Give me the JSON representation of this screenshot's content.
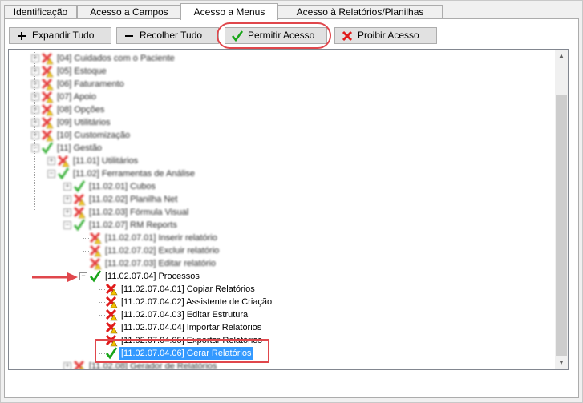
{
  "tabs": [
    {
      "label": "Identificação"
    },
    {
      "label": "Acesso a Campos"
    },
    {
      "label": "Acesso a Menus"
    },
    {
      "label": "Acesso à Relatórios/Planilhas"
    }
  ],
  "toolbar": {
    "expand_label": "Expandir Tudo",
    "collapse_label": "Recolher Tudo",
    "allow_label": "Permitir Acesso",
    "deny_label": "Proibir Acesso"
  },
  "colors": {
    "allowed": "#1aa51a",
    "denied": "#e01b1b",
    "warning": "#f2c200",
    "annotation": "#e0474c",
    "selection": "#3399ff"
  },
  "tree": [
    {
      "label": "[04] Cuidados com o Paciente",
      "status": "denied-warning",
      "blurred": true
    },
    {
      "label": "[05] Estoque",
      "status": "denied-warning",
      "blurred": true
    },
    {
      "label": "[06] Faturamento",
      "status": "denied-warning",
      "blurred": true
    },
    {
      "label": "[07] Apoio",
      "status": "denied-warning",
      "blurred": true
    },
    {
      "label": "[08] Opções",
      "status": "denied-warning",
      "blurred": true
    },
    {
      "label": "[09] Utilitários",
      "status": "denied-warning",
      "blurred": true
    },
    {
      "label": "[10] Customização",
      "status": "denied-warning",
      "blurred": true
    },
    {
      "label": "[11] Gestão",
      "status": "allowed",
      "blurred": true
    },
    {
      "label": "[11.01] Utilitários",
      "status": "denied-warning",
      "blurred": true
    },
    {
      "label": "[11.02] Ferramentas de Análise",
      "status": "allowed",
      "blurred": true
    },
    {
      "label": "[11.02.01] Cubos",
      "status": "allowed",
      "blurred": true
    },
    {
      "label": "[11.02.02] Planilha Net",
      "status": "denied-warning",
      "blurred": true
    },
    {
      "label": "[11.02.03] Fórmula Visual",
      "status": "denied-warning",
      "blurred": true
    },
    {
      "label": "[11.02.07] RM Reports",
      "status": "allowed",
      "blurred": true
    },
    {
      "label": "[11.02.07.01] Inserir relatório",
      "status": "denied-warning",
      "blurred": true
    },
    {
      "label": "[11.02.07.02] Excluir relatório",
      "status": "denied-warning",
      "blurred": true
    },
    {
      "label": "[11.02.07.03] Editar relatório",
      "status": "denied-warning",
      "blurred": true
    },
    {
      "label": "[11.02.07.04] Processos",
      "status": "allowed",
      "blurred": false
    },
    {
      "label": "[11.02.07.04.01] Copiar Relatórios",
      "status": "denied-warning",
      "blurred": false
    },
    {
      "label": "[11.02.07.04.02] Assistente de Criação",
      "status": "denied-warning",
      "blurred": false
    },
    {
      "label": "[11.02.07.04.03] Editar Estrutura",
      "status": "denied-warning",
      "blurred": false
    },
    {
      "label": "[11.02.07.04.04] Importar Relatórios",
      "status": "denied-warning",
      "blurred": false
    },
    {
      "label": "[11.02.07.04.05] Exportar Relatórios",
      "status": "denied-warning",
      "blurred": false
    },
    {
      "label": "[11.02.07.04.06] Gerar Relatórios",
      "status": "allowed",
      "blurred": false,
      "selected": true
    },
    {
      "label": "[11.02.08] Gerador de Relatórios",
      "status": "denied-warning",
      "blurred": true
    }
  ]
}
